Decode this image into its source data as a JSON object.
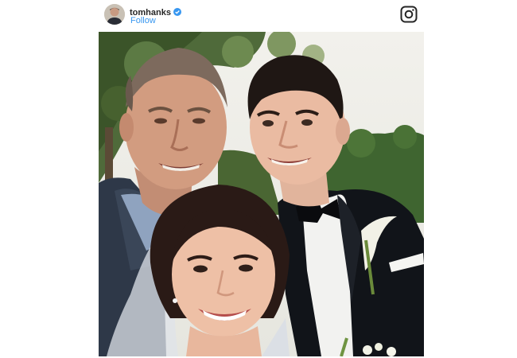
{
  "post": {
    "username": "tomhanks",
    "follow_label": "Follow",
    "verified_icon": "verified-badge-icon",
    "brand_icon": "instagram-icon",
    "accent_color": "#3897f0",
    "photo_description_icon": "wedding-selfie-photo"
  }
}
